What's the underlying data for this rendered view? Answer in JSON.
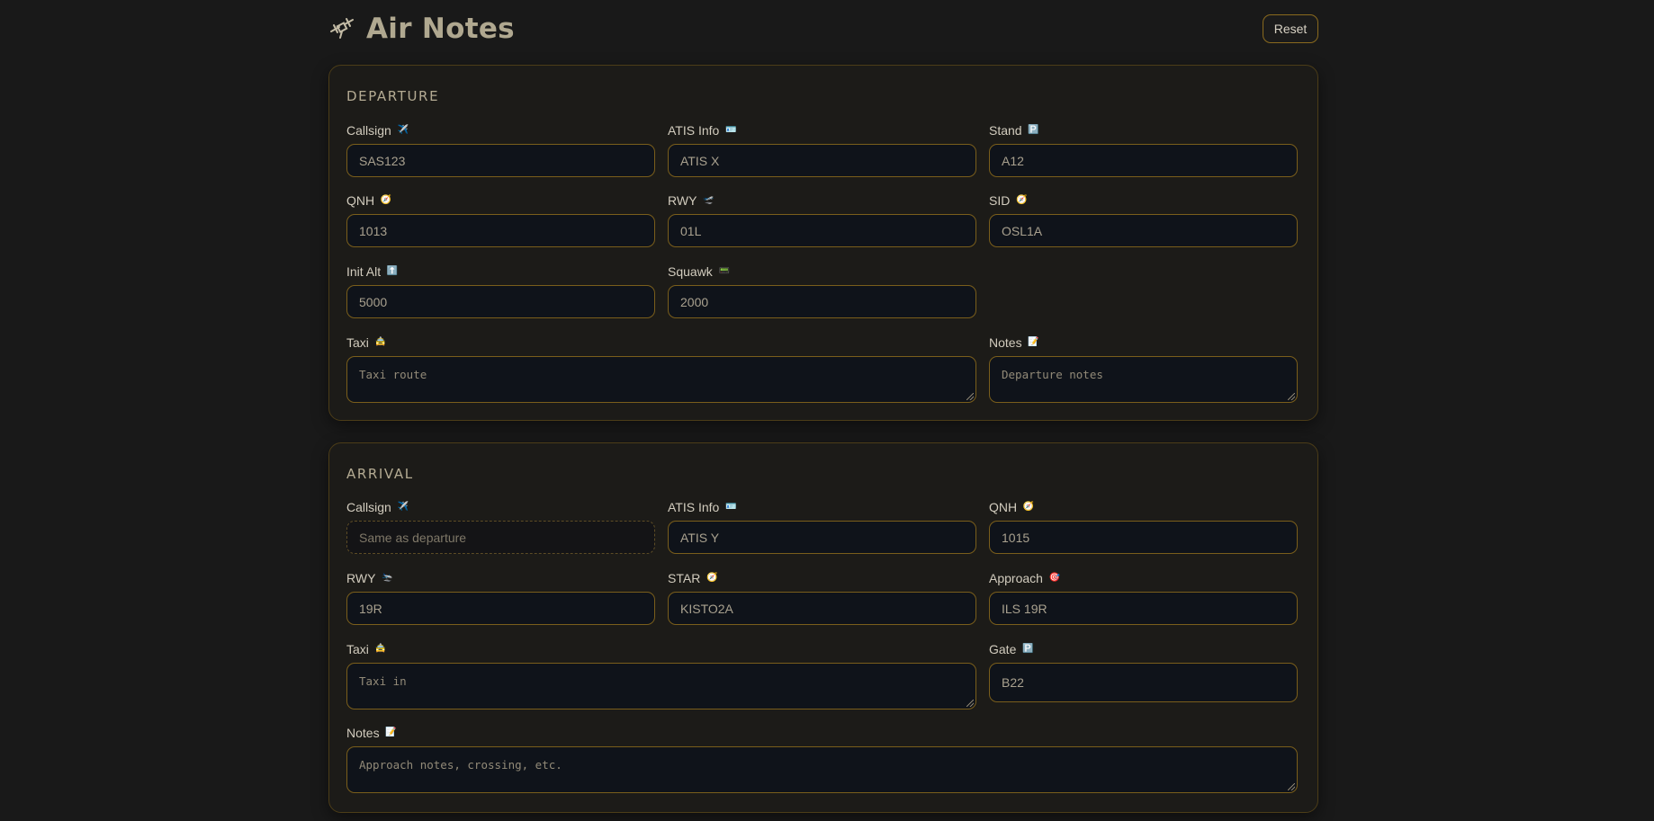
{
  "header": {
    "title": "Air Notes",
    "reset_label": "Reset"
  },
  "departure": {
    "title": "DEPARTURE",
    "callsign": {
      "label": "Callsign",
      "value": "SAS123",
      "icon": "airplane-icon"
    },
    "atis": {
      "label": "ATIS Info",
      "value": "ATIS X",
      "icon": "id-card-icon"
    },
    "stand": {
      "label": "Stand",
      "value": "A12",
      "icon": "parking-icon"
    },
    "qnh": {
      "label": "QNH",
      "value": "1013",
      "icon": "gauge-icon"
    },
    "rwy": {
      "label": "RWY",
      "value": "01L",
      "icon": "takeoff-icon"
    },
    "sid": {
      "label": "SID",
      "value": "OSL1A",
      "icon": "compass-icon"
    },
    "init_alt": {
      "label": "Init Alt",
      "value": "5000",
      "icon": "up-arrow-icon"
    },
    "squawk": {
      "label": "Squawk",
      "value": "2000",
      "icon": "transponder-icon"
    },
    "taxi": {
      "label": "Taxi",
      "placeholder": "Taxi route",
      "icon": "taxi-sign-icon"
    },
    "notes": {
      "label": "Notes",
      "placeholder": "Departure notes",
      "icon": "memo-icon"
    }
  },
  "arrival": {
    "title": "ARRIVAL",
    "callsign": {
      "label": "Callsign",
      "placeholder": "Same as departure",
      "icon": "airplane-icon"
    },
    "atis": {
      "label": "ATIS Info",
      "value": "ATIS Y",
      "icon": "id-card-icon"
    },
    "qnh": {
      "label": "QNH",
      "value": "1015",
      "icon": "gauge-icon"
    },
    "rwy": {
      "label": "RWY",
      "value": "19R",
      "icon": "landing-icon"
    },
    "star": {
      "label": "STAR",
      "value": "KISTO2A",
      "icon": "compass-icon"
    },
    "approach": {
      "label": "Approach",
      "value": "ILS 19R",
      "icon": "target-icon"
    },
    "taxi": {
      "label": "Taxi",
      "placeholder": "Taxi in",
      "icon": "taxi-sign-icon"
    },
    "gate": {
      "label": "Gate",
      "value": "B22",
      "icon": "parking-icon"
    },
    "notes": {
      "label": "Notes",
      "placeholder": "Approach notes, crossing, etc.",
      "icon": "memo-icon"
    }
  },
  "colors": {
    "background": "#191919",
    "accent_border": "#7a5e1b",
    "input_bg": "#0f131a"
  }
}
